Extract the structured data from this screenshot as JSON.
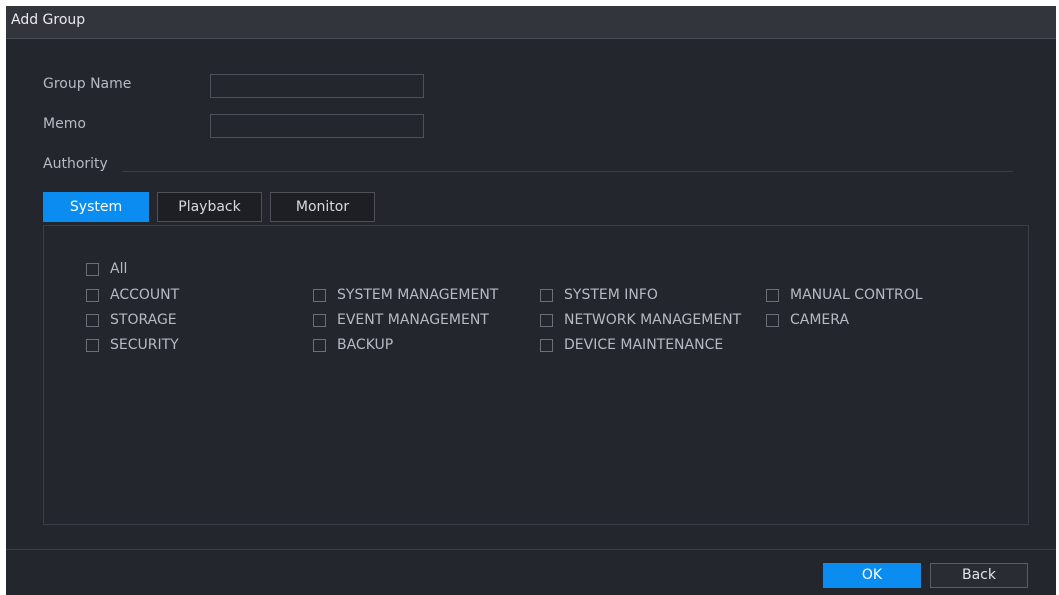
{
  "dialog": {
    "title": "Add Group"
  },
  "form": {
    "group_name_label": "Group Name",
    "group_name_value": "",
    "memo_label": "Memo",
    "memo_value": "",
    "authority_label": "Authority"
  },
  "tabs": [
    {
      "label": "System",
      "active": true
    },
    {
      "label": "Playback",
      "active": false
    },
    {
      "label": "Monitor",
      "active": false
    }
  ],
  "permissions": {
    "all": {
      "label": "All",
      "checked": false
    },
    "items": [
      {
        "label": "ACCOUNT",
        "checked": false
      },
      {
        "label": "SYSTEM MANAGEMENT",
        "checked": false
      },
      {
        "label": "SYSTEM INFO",
        "checked": false
      },
      {
        "label": "MANUAL CONTROL",
        "checked": false
      },
      {
        "label": "STORAGE",
        "checked": false
      },
      {
        "label": "EVENT MANAGEMENT",
        "checked": false
      },
      {
        "label": "NETWORK MANAGEMENT",
        "checked": false
      },
      {
        "label": "CAMERA",
        "checked": false
      },
      {
        "label": "SECURITY",
        "checked": false
      },
      {
        "label": "BACKUP",
        "checked": false
      },
      {
        "label": "DEVICE MAINTENANCE",
        "checked": false
      }
    ]
  },
  "footer": {
    "ok_label": "OK",
    "back_label": "Back"
  },
  "colors": {
    "accent": "#0b8cf0",
    "background": "#24262d",
    "titlebar": "#33353d"
  }
}
